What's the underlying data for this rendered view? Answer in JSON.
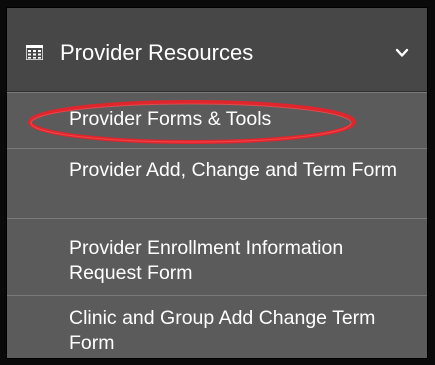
{
  "menu": {
    "header": {
      "icon": "calendar-icon",
      "title": "Provider Resources",
      "toggle_icon": "chevron-down-icon"
    },
    "items": [
      {
        "label": "Provider Forms & Tools",
        "highlighted": true
      },
      {
        "label": "Provider Add, Change and Term Form"
      },
      {
        "label": "Provider Enrollment Information Request Form"
      },
      {
        "label": "Clinic and Group Add Change Term Form"
      }
    ],
    "colors": {
      "header_bg": "#474747",
      "item_bg": "#5b5b5b",
      "text": "#ffffff",
      "highlight_oval": "#e0262d"
    }
  }
}
